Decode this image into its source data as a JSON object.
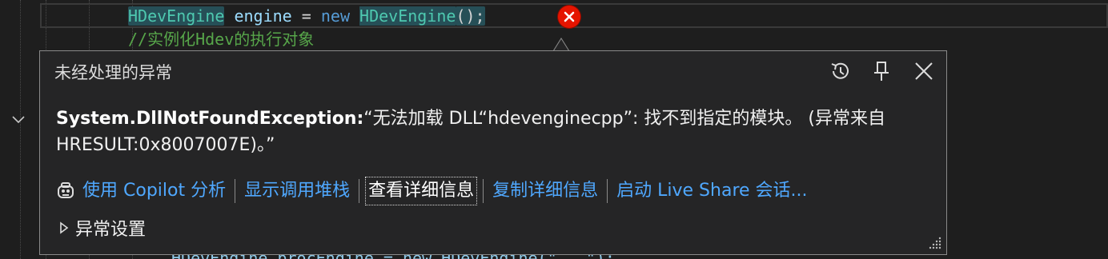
{
  "editor": {
    "code_tokens": {
      "type1": "HDevEngine",
      "ident": "engine",
      "op": "=",
      "kw_new": "new",
      "type2": "HDevEngine",
      "tail": "();"
    },
    "comment": "//实例化Hdev的执行对象",
    "line3_partial": "HDevEngine procEngine = new HDevEngine(\"...\");"
  },
  "exception_popup": {
    "title": "未经处理的异常",
    "exception_type": "System.DllNotFoundException:",
    "message": "“无法加载 DLL“hdevenginecpp”: 找不到指定的模块。 (异常来自 HRESULT:0x8007007E)。”",
    "actions": [
      {
        "label": "使用 Copilot 分析",
        "icon": "copilot-icon"
      },
      {
        "label": "显示调用堆栈"
      },
      {
        "label": "查看详细信息"
      },
      {
        "label": "复制详细信息"
      },
      {
        "label": "启动 Live Share 会话..."
      }
    ],
    "settings_label": "异常设置"
  },
  "icons": {
    "error": "error-x-icon",
    "history": "history-icon",
    "pin": "pin-icon",
    "close": "close-icon",
    "fold": "chevron-down-icon",
    "expand": "caret-right-icon",
    "resize": "resize-grip-icon"
  },
  "colors": {
    "error_red": "#e51400",
    "link_blue": "#4fa8ff",
    "type_teal": "#4ec9b0",
    "keyword_blue": "#569cd6",
    "comment_green": "#57a64a",
    "popup_bg": "#252526"
  }
}
